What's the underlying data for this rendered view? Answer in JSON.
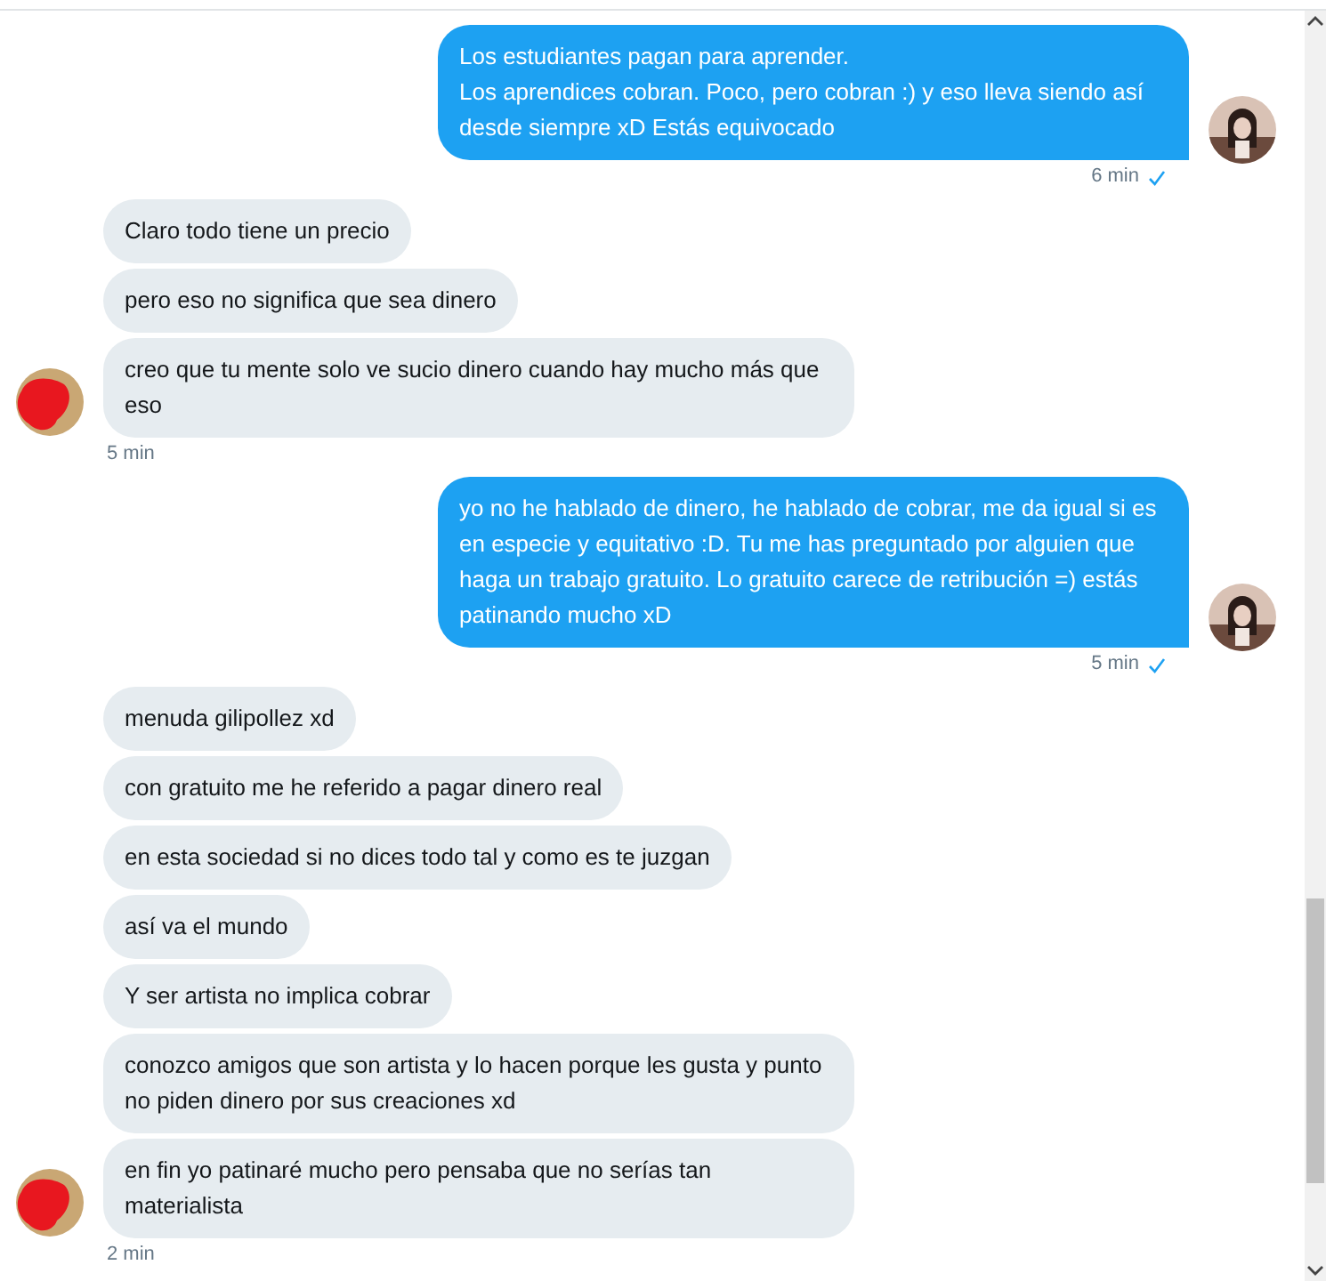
{
  "messages": [
    {
      "kind": "sent",
      "bubbles": [
        "Los estudiantes pagan para aprender.\nLos aprendices cobran. Poco, pero cobran :) y eso lleva siendo así desde siempre xD Estás equivocado"
      ],
      "time": "6 min",
      "read": true
    },
    {
      "kind": "received",
      "bubbles": [
        "Claro todo tiene un precio",
        "pero eso no significa que sea dinero",
        "creo que tu mente solo ve sucio dinero cuando hay mucho más que eso"
      ],
      "time": "5 min"
    },
    {
      "kind": "sent",
      "bubbles": [
        "yo no he hablado de dinero, he hablado de cobrar, me da igual si es en especie y equitativo :D. Tu me has preguntado por alguien que haga un trabajo gratuito. Lo gratuito carece de retribución =) estás patinando mucho xD"
      ],
      "time": "5 min",
      "read": true
    },
    {
      "kind": "received",
      "bubbles": [
        "menuda gilipollez xd",
        "con gratuito me he referido a pagar dinero real",
        "en esta sociedad si no dices todo tal y como es te juzgan",
        "así va el mundo",
        "Y ser artista no implica cobrar",
        "conozco amigos que son artista y lo hacen porque les gusta y punto no piden dinero por sus creaciones xd",
        "en fin yo patinaré mucho pero pensaba que no serías tan materialista"
      ],
      "time": "2 min"
    }
  ]
}
